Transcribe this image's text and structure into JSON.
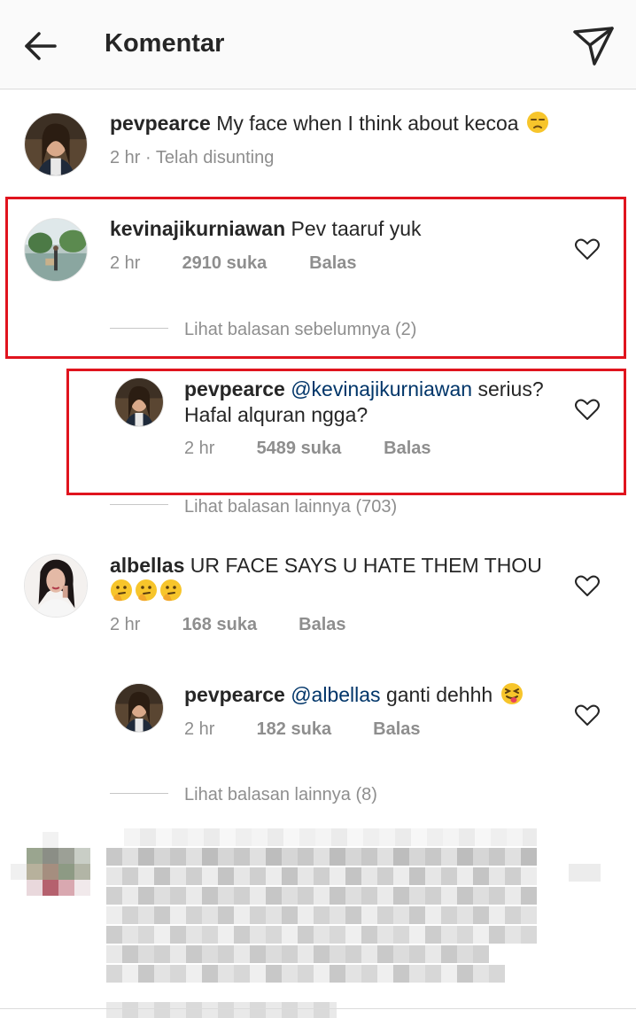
{
  "header": {
    "title": "Komentar"
  },
  "caption": {
    "username": "pevpearce",
    "text": "My face when I think about kecoa",
    "emoji": "unamused-face-emoji",
    "time": "2 hr",
    "edited": "· Telah disunting"
  },
  "comments": [
    {
      "username": "kevinajikurniawan",
      "text": "Pev taaruf yuk",
      "time": "2 hr",
      "likes": "2910 suka",
      "reply": "Balas",
      "view_replies": "Lihat balasan sebelumnya (2)"
    },
    {
      "username": "pevpearce",
      "mention": "@kevinajikurniawan",
      "text": "serius? Hafal alquran ngga?",
      "text_line1": "serius?",
      "text_line2": "Hafal alquran ngga?",
      "time": "2 hr",
      "likes": "5489 suka",
      "reply": "Balas",
      "view_replies": "Lihat balasan lainnya (703)"
    },
    {
      "username": "albellas",
      "text": "UR FACE SAYS U HATE THEM THOU",
      "emoji": "thinking-face-emoji",
      "time": "2 hr",
      "likes": "168 suka",
      "reply": "Balas"
    },
    {
      "username": "pevpearce",
      "mention": "@albellas",
      "text": "ganti dehhh",
      "emoji": "squinting-tongue-face-emoji",
      "time": "2 hr",
      "likes": "182 suka",
      "reply": "Balas",
      "view_replies": "Lihat balasan lainnya (8)"
    }
  ],
  "colors": {
    "highlight": "#e0141e",
    "mention": "#003569",
    "meta": "#8e8e8e"
  }
}
